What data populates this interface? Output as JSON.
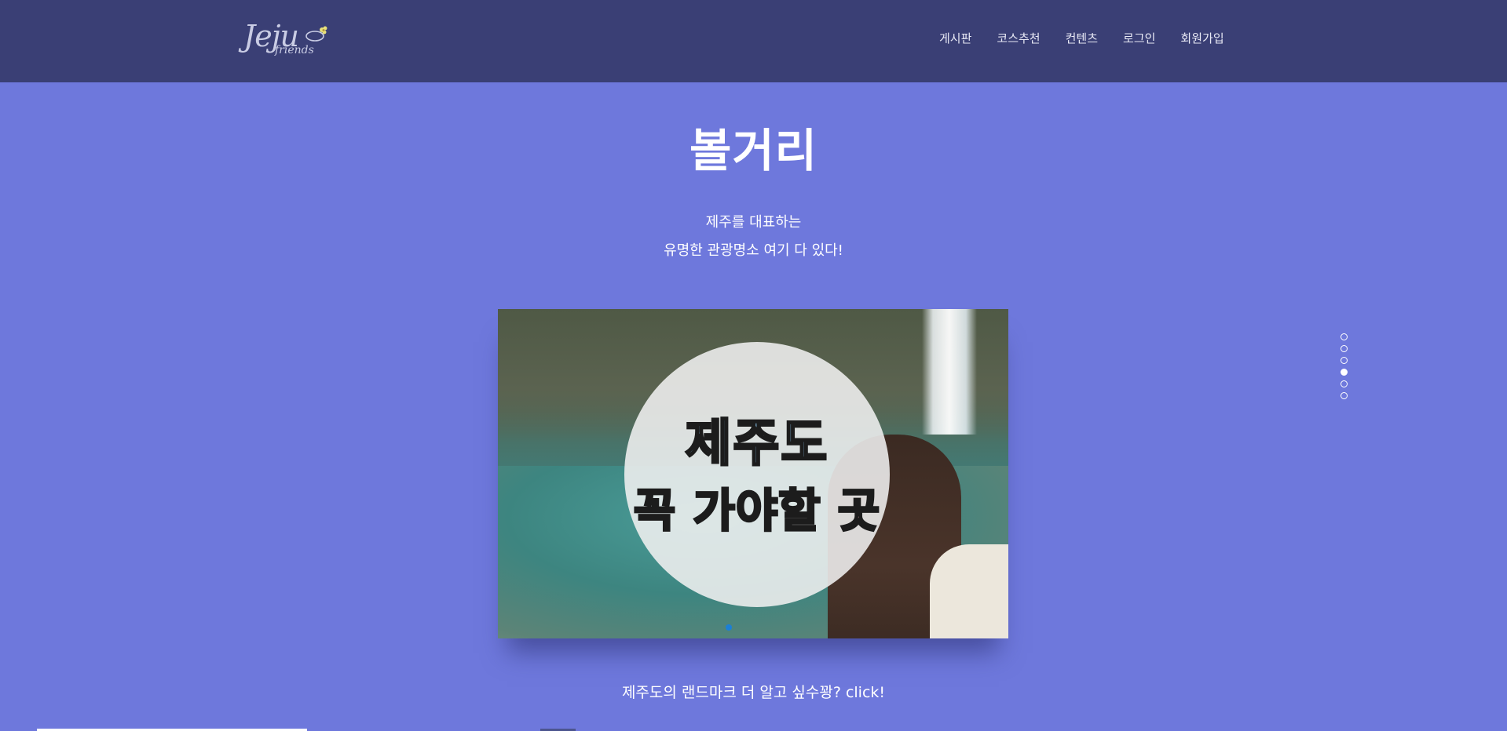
{
  "header": {
    "logo_text": "Jeju",
    "logo_subtext": "friends",
    "nav": [
      "게시판",
      "코스추천",
      "컨텐츠",
      "로그인",
      "회원가입"
    ]
  },
  "section": {
    "title": "볼거리",
    "subtitle_line1": "제주를 대표하는",
    "subtitle_line2": "유명한 관광명소 여기 다 있다!",
    "slide_line1": "제주도",
    "slide_line2": "꼭 가야할 곳",
    "caption": "제주도의 랜드마크 더 알고 싶수꽝? click!"
  },
  "pager": {
    "count": 6,
    "active_index": 3
  },
  "colors": {
    "header_bg": "#3a3f75",
    "page_bg": "#6e78dc",
    "accent_dot": "#1b7fd6"
  }
}
